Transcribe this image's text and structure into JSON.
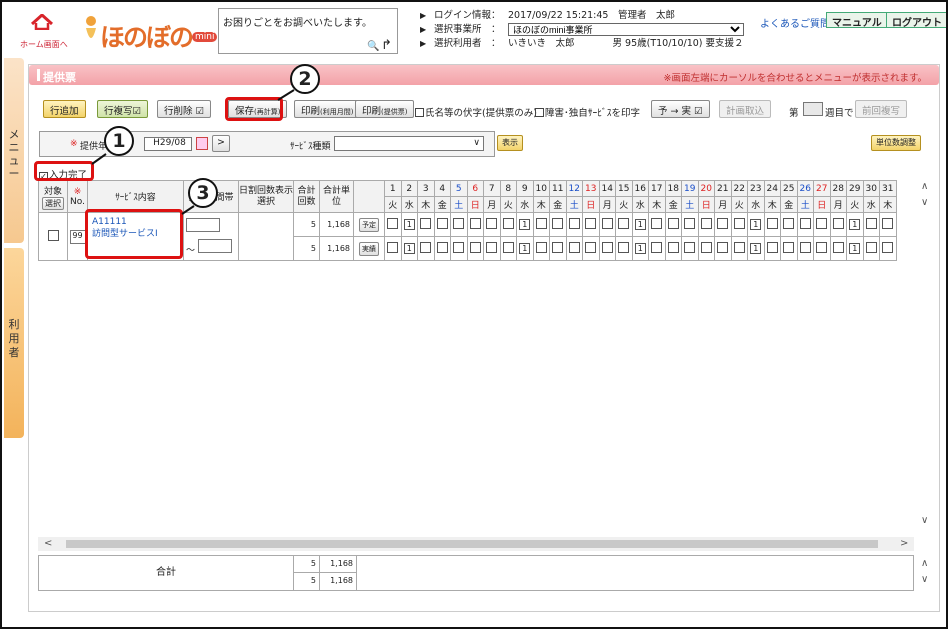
{
  "header": {
    "home_label": "ホーム画面へ",
    "logo_text": "ほのぼの",
    "logo_badge": "mini",
    "search_placeholder": "お困りごとをお調べいたします。",
    "search_icon": "magnifier-icon",
    "login_key": "ログイン情報：",
    "login_value": "2017/09/22 15:21:45　管理者　太郎",
    "office_key": "選択事業所　：",
    "office_value": "ほのぼのmini事業所",
    "user_key": "選択利用者　：",
    "user_value": "いきいき　太郎　　　　男 95歳(T10/10/10) 要支援２",
    "faq": "よくあるご質問",
    "manual": "マニュアル",
    "logout": "ログアウト"
  },
  "side": {
    "menu_label": "メニュー",
    "user_label": "利用者"
  },
  "page": {
    "title": "提供票",
    "note": "※画面左端にカーソルを合わせるとメニューが表示されます。"
  },
  "toolbar": {
    "add_row": "行追加",
    "copy_row": "行複写☑",
    "delete_row": "行削除 ☑",
    "save": "保存",
    "save_sub": "(再計算)",
    "print_use": "印刷",
    "print_use_sub": "(利用月間)",
    "print_offer": "印刷",
    "print_offer_sub": "(提供票)",
    "chk_fuseji": "氏名等の伏字(提供票のみ)",
    "chk_shogai": "障害･独自ｻｰﾋﾞｽを印字",
    "plan_to_actual": "予 → 実 ☑",
    "plan_fetch": "計画取込",
    "week_prefix": "第",
    "week_suffix": "週目で",
    "prev_copy": "前回複写"
  },
  "filter": {
    "offer_label": "提供年月",
    "offer_mark": "※",
    "offer_value": "H29/08",
    "next": ">",
    "service_type_label": "ｻｰﾋﾞｽ種類",
    "show": "表示",
    "unit_adjust": "単位数調整"
  },
  "input_done": "入力完了",
  "grid": {
    "h_target": "対象",
    "h_select": "選択",
    "h_no_mark": "※",
    "h_no": "No.",
    "h_service": "ｻｰﾋﾞｽ内容",
    "h_time": "提供時間帯",
    "h_daily": "日割回数表示選択",
    "h_count": "合計回数",
    "h_units": "合計単位",
    "days": [
      {
        "d": "1",
        "w": "火",
        "t": ""
      },
      {
        "d": "2",
        "w": "水",
        "t": ""
      },
      {
        "d": "3",
        "w": "木",
        "t": ""
      },
      {
        "d": "4",
        "w": "金",
        "t": ""
      },
      {
        "d": "5",
        "w": "土",
        "t": "sat"
      },
      {
        "d": "6",
        "w": "日",
        "t": "sun"
      },
      {
        "d": "7",
        "w": "月",
        "t": ""
      },
      {
        "d": "8",
        "w": "火",
        "t": ""
      },
      {
        "d": "9",
        "w": "水",
        "t": ""
      },
      {
        "d": "10",
        "w": "木",
        "t": ""
      },
      {
        "d": "11",
        "w": "金",
        "t": ""
      },
      {
        "d": "12",
        "w": "土",
        "t": "sat"
      },
      {
        "d": "13",
        "w": "日",
        "t": "sun"
      },
      {
        "d": "14",
        "w": "月",
        "t": ""
      },
      {
        "d": "15",
        "w": "火",
        "t": ""
      },
      {
        "d": "16",
        "w": "水",
        "t": ""
      },
      {
        "d": "17",
        "w": "木",
        "t": ""
      },
      {
        "d": "18",
        "w": "金",
        "t": ""
      },
      {
        "d": "19",
        "w": "土",
        "t": "sat"
      },
      {
        "d": "20",
        "w": "日",
        "t": "sun"
      },
      {
        "d": "21",
        "w": "月",
        "t": ""
      },
      {
        "d": "22",
        "w": "火",
        "t": ""
      },
      {
        "d": "23",
        "w": "水",
        "t": ""
      },
      {
        "d": "24",
        "w": "木",
        "t": ""
      },
      {
        "d": "25",
        "w": "金",
        "t": ""
      },
      {
        "d": "26",
        "w": "土",
        "t": "sat"
      },
      {
        "d": "27",
        "w": "日",
        "t": "sun"
      },
      {
        "d": "28",
        "w": "月",
        "t": ""
      },
      {
        "d": "29",
        "w": "火",
        "t": ""
      },
      {
        "d": "30",
        "w": "水",
        "t": ""
      },
      {
        "d": "31",
        "w": "木",
        "t": ""
      }
    ],
    "row": {
      "no": "99",
      "service_code": "A11111",
      "service_name": "訪問型サービスⅠ",
      "time_sep": "～",
      "plan_count": "5",
      "plan_units": "1,168",
      "plan_label": "予定",
      "actual_count": "5",
      "actual_units": "1,168",
      "actual_label": "実績",
      "plan_marks": [
        "",
        "1",
        "",
        "",
        "",
        "",
        "",
        "",
        "1",
        "",
        "",
        "",
        "",
        "",
        "",
        "1",
        "",
        "",
        "",
        "",
        "",
        "",
        "1",
        "",
        "",
        "",
        "",
        "",
        "1",
        "",
        ""
      ],
      "actual_marks": [
        "",
        "1",
        "",
        "",
        "",
        "",
        "",
        "",
        "1",
        "",
        "",
        "",
        "",
        "",
        "",
        "1",
        "",
        "",
        "",
        "",
        "",
        "",
        "1",
        "",
        "",
        "",
        "",
        "",
        "1",
        "",
        ""
      ]
    }
  },
  "totals": {
    "label": "合計",
    "count1": "5",
    "units1": "1,168",
    "count2": "5",
    "units2": "1,168"
  },
  "callouts": [
    "1",
    "2",
    "3"
  ]
}
